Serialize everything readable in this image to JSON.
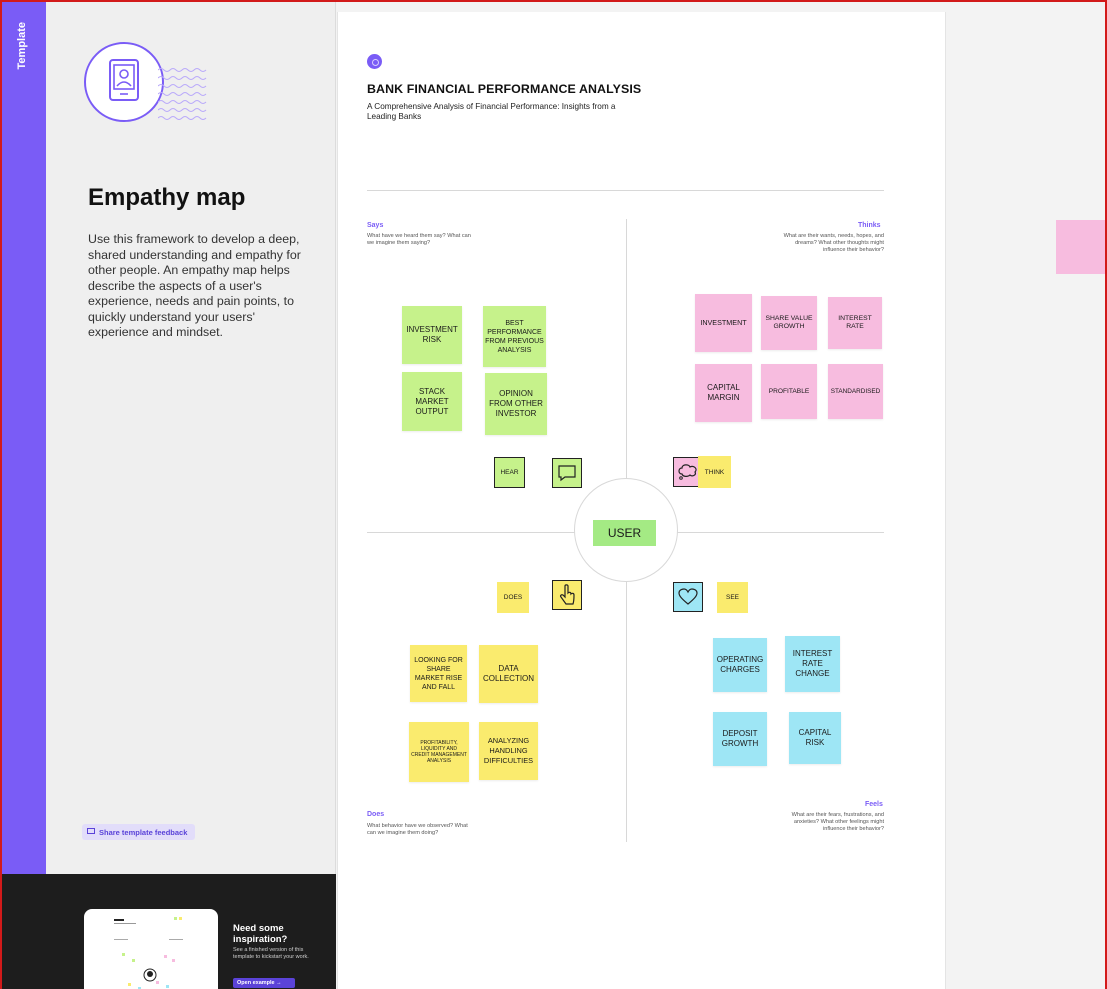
{
  "sidebar": {
    "tag": "Template",
    "title": "Empathy map",
    "description": "Use this framework to develop a deep, shared understanding and empathy for other people. An empathy map helps describe the aspects of a user's experience, needs and pain points, to quickly understand your users' experience and mindset.",
    "feedback_label": "Share template feedback",
    "inspiration": {
      "heading": "Need some inspiration?",
      "text": "See a finished version of this template to kickstart your work.",
      "button": "Open example"
    }
  },
  "board": {
    "title": "BANK FINANCIAL PERFORMANCE ANALYSIS",
    "subtitle": "A Comprehensive Analysis of Financial Performance: Insights from a Leading Banks",
    "center": "USER",
    "quadrants": {
      "says": {
        "label": "Says",
        "hint": "What have we heard them say? What can we imagine them saying?"
      },
      "thinks": {
        "label": "Thinks",
        "hint": "What are their wants, needs, hopes, and dreams? What other thoughts might influence their behavior?"
      },
      "does": {
        "label": "Does",
        "hint": "What behavior have we observed? What can we imagine them doing?"
      },
      "feels": {
        "label": "Feels",
        "hint": "What are their fears, frustrations, and anxieties? What other feelings might influence their behavior?"
      }
    },
    "tags": {
      "hear": "HEAR",
      "think": "THINK",
      "does": "DOES",
      "see": "SEE"
    },
    "says_notes": [
      "INVESTMENT RISK",
      "BEST PERFORMANCE FROM PREVIOUS ANALYSIS",
      "STACK MARKET OUTPUT",
      "OPINION FROM OTHER INVESTOR"
    ],
    "thinks_notes": [
      "INVESTMENT",
      "SHARE VALUE GROWTH",
      "INTEREST RATE",
      "CAPITAL MARGIN",
      "PROFITABLE",
      "STANDARDISED"
    ],
    "does_notes": [
      "LOOKING FOR SHARE MARKET RISE AND FALL",
      "DATA COLLECTION",
      "PROFITABILITY, LIQUIDITY AND CREDIT MANAGEMENT ANALYSIS",
      "ANALYZING HANDLING DIFFICULTIES"
    ],
    "feels_notes": [
      "OPERATING CHARGES",
      "INTEREST RATE CHANGE",
      "DEPOSIT GROWTH",
      "CAPITAL RISK"
    ]
  },
  "colors": {
    "accent": "#7a5cf6",
    "green": "#c6f28b",
    "pink": "#f7bcdf",
    "yellow": "#faeb6e",
    "blue": "#9ee6f5",
    "border": "#d21a1a"
  },
  "icons": [
    "portrait-icon",
    "speech-bubble-icon",
    "thought-bubble-icon",
    "pointing-hand-icon",
    "heart-icon",
    "chat-icon",
    "arrow-right-icon"
  ]
}
